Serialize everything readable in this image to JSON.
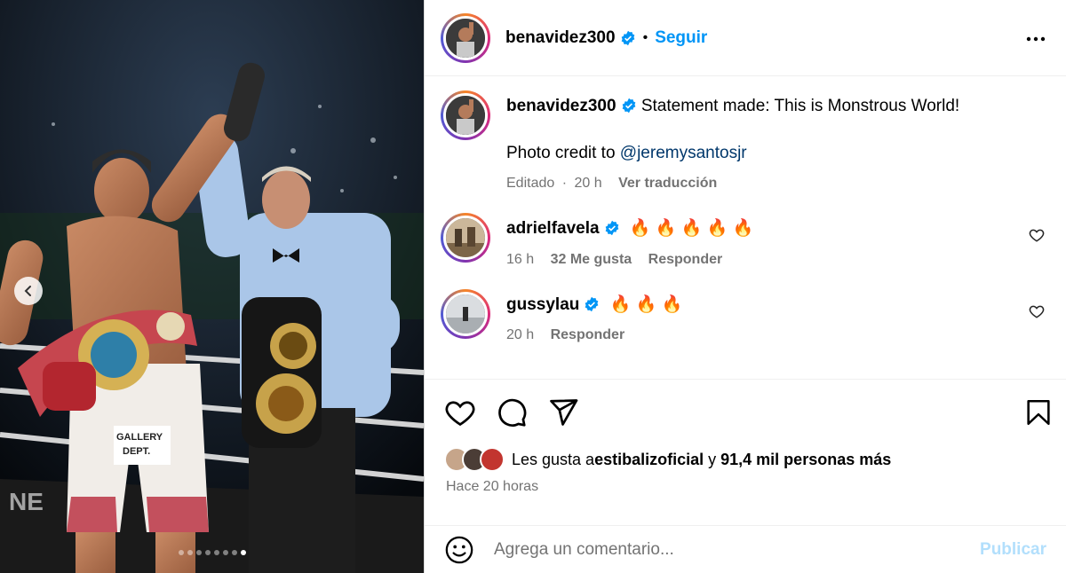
{
  "post": {
    "carousel": {
      "total_slides": 8,
      "active_index": 7
    },
    "author": {
      "username": "benavidez300",
      "verified": true
    },
    "separator": "•",
    "follow_label": "Seguir"
  },
  "caption": {
    "username": "benavidez300",
    "text": "Statement made: This is Monstrous World!",
    "credit_prefix": "Photo credit to ",
    "credit_mention": "@jeremysantosjr",
    "edited": "Editado",
    "time": "20 h",
    "translate": "Ver traducción"
  },
  "comments": [
    {
      "username": "adrielfavela",
      "verified": true,
      "text": "🔥 🔥 🔥 🔥 🔥",
      "time": "16 h",
      "likes": "32 Me gusta",
      "reply": "Responder"
    },
    {
      "username": "gussylau",
      "verified": true,
      "text": "🔥 🔥 🔥",
      "time": "20 h",
      "reply": "Responder"
    }
  ],
  "likes": {
    "prefix": "Les gusta a ",
    "user": "estibalizoficial",
    "and": " y ",
    "others": "91,4 mil personas más"
  },
  "timestamp": "Hace 20 horas",
  "composer": {
    "placeholder": "Agrega un comentario...",
    "post_label": "Publicar"
  },
  "colors": {
    "accent": "#0095f6",
    "verified": "#0095f6",
    "muted": "#737373",
    "post_disabled": "#b2dffc"
  },
  "icons": [
    "chevron-left-icon",
    "more-icon",
    "verified-icon",
    "heart-icon",
    "comment-icon",
    "share-icon",
    "bookmark-icon",
    "emoji-icon"
  ]
}
